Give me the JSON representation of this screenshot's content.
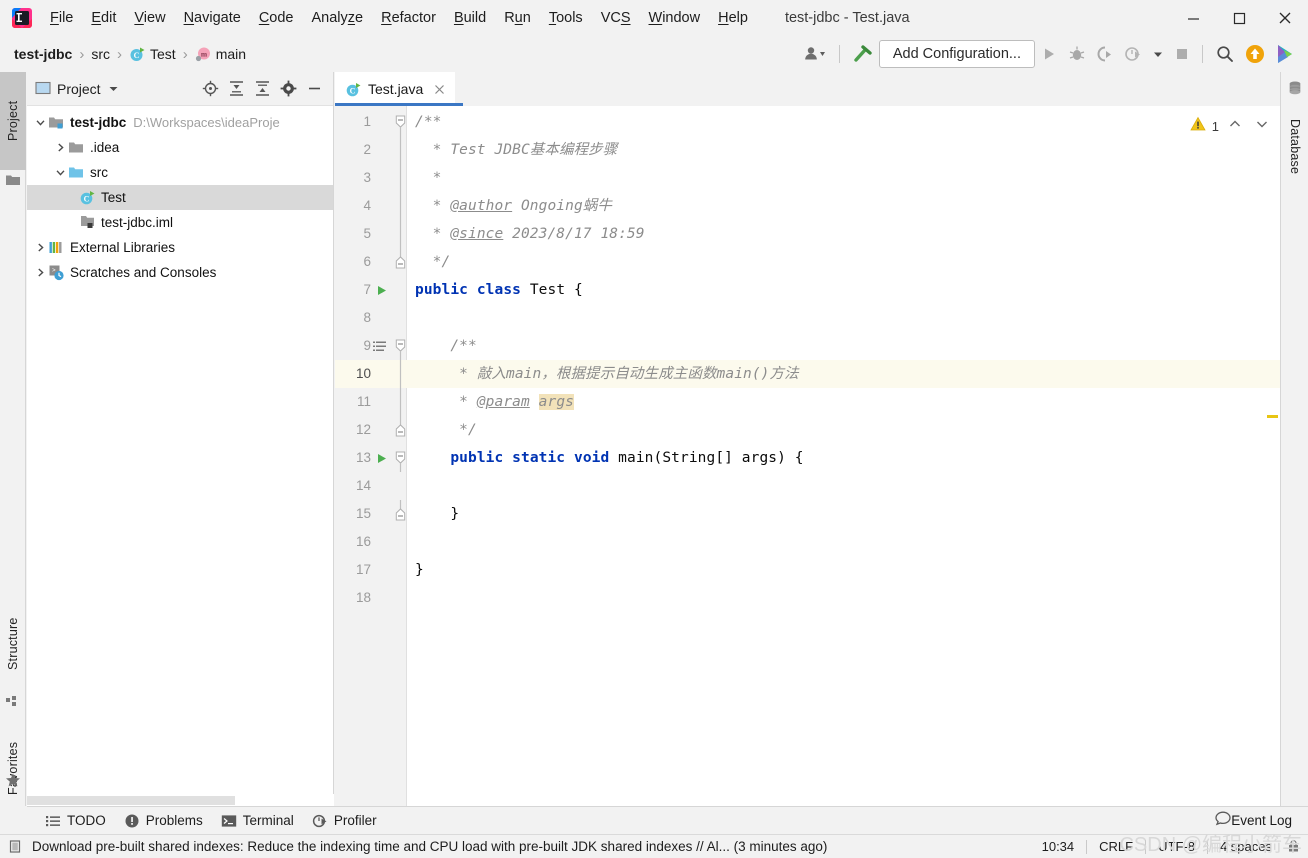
{
  "window": {
    "title": "test-jdbc - Test.java",
    "minimize_label": "Minimize",
    "maximize_label": "Maximize",
    "close_label": "Close"
  },
  "menu": {
    "items": [
      {
        "label": "File"
      },
      {
        "label": "Edit"
      },
      {
        "label": "View"
      },
      {
        "label": "Navigate"
      },
      {
        "label": "Code"
      },
      {
        "label": "Analyze"
      },
      {
        "label": "Refactor"
      },
      {
        "label": "Build"
      },
      {
        "label": "Run"
      },
      {
        "label": "Tools"
      },
      {
        "label": "VCS"
      },
      {
        "label": "Window"
      },
      {
        "label": "Help"
      }
    ]
  },
  "navbar": {
    "breadcrumbs": [
      {
        "label": "test-jdbc",
        "icon": "none"
      },
      {
        "label": "src",
        "icon": "none"
      },
      {
        "label": "Test",
        "icon": "class-icon"
      },
      {
        "label": "main",
        "icon": "method-icon"
      }
    ],
    "separator": "›",
    "run_config_button": "Add Configuration...",
    "icons": [
      "user-avatar-icon",
      "build-hammer-icon",
      "run-icon",
      "debug-icon",
      "run-coverage-icon",
      "profile-icon",
      "dropdown-arrow-icon",
      "stop-icon",
      "search-everywhere-icon",
      "update-project-icon",
      "idea-ultimate-icon"
    ]
  },
  "left_strip": {
    "tabs": [
      {
        "label": "Project",
        "icon": "project-folder-icon",
        "active": true
      },
      {
        "label": "Structure",
        "icon": "structure-icon",
        "active": false
      },
      {
        "label": "Favorites",
        "icon": "favorites-star-icon",
        "active": false
      }
    ]
  },
  "right_strip": {
    "tabs": [
      {
        "label": "Database",
        "icon": "database-icon",
        "active": false
      }
    ]
  },
  "project_panel": {
    "title": "Project",
    "title_dropdown_icon": "chevron-down-icon",
    "header_icons": [
      "locate-icon",
      "expand-all-icon",
      "collapse-all-icon",
      "settings-gear-icon",
      "hide-icon"
    ],
    "tree": [
      {
        "label": "test-jdbc",
        "path": "D:\\Workspaces\\ideaProje",
        "depth": 0,
        "arrow": "down",
        "icon": "module-folder-icon",
        "bold": true,
        "selected": false
      },
      {
        "label": ".idea",
        "path": "",
        "depth": 1,
        "arrow": "right",
        "icon": "folder-icon",
        "bold": false,
        "selected": false
      },
      {
        "label": "src",
        "path": "",
        "depth": 1,
        "arrow": "down",
        "icon": "source-folder-icon",
        "bold": false,
        "selected": false
      },
      {
        "label": "Test",
        "path": "",
        "depth": 2,
        "arrow": "none",
        "icon": "class-icon",
        "bold": false,
        "selected": true
      },
      {
        "label": "test-jdbc.iml",
        "path": "",
        "depth": 2,
        "arrow": "none",
        "icon": "iml-file-icon",
        "bold": false,
        "selected": false
      },
      {
        "label": "External Libraries",
        "path": "",
        "depth": 0,
        "arrow": "right",
        "icon": "libraries-icon",
        "bold": false,
        "selected": false
      },
      {
        "label": "Scratches and Consoles",
        "path": "",
        "depth": 0,
        "arrow": "right",
        "icon": "scratches-icon",
        "bold": false,
        "selected": false
      }
    ]
  },
  "editor": {
    "tab": {
      "name": "Test.java",
      "icon": "java-class-icon",
      "close_icon": "close-icon"
    },
    "inspection": {
      "warning_count": "1",
      "warning_icon": "warning-triangle-icon",
      "prev_icon": "chevron-up-icon",
      "next_icon": "chevron-down-icon"
    },
    "lines": [
      {
        "n": "1",
        "indent": 0,
        "html": "<span class='cm'>/**</span>",
        "fold": "start",
        "run": false,
        "current": false
      },
      {
        "n": "2",
        "indent": 0,
        "html": "<span class='cm'>  * Test JDBC基本编程步骤</span>",
        "fold": "bar",
        "run": false,
        "current": false
      },
      {
        "n": "3",
        "indent": 0,
        "html": "<span class='cm'>  *</span>",
        "fold": "bar",
        "run": false,
        "current": false
      },
      {
        "n": "4",
        "indent": 0,
        "html": "<span class='cm'>  * </span><span class='cm-tag'>@author</span><span class='cm'> Ongoing蜗牛</span>",
        "fold": "bar",
        "run": false,
        "current": false
      },
      {
        "n": "5",
        "indent": 0,
        "html": "<span class='cm'>  * </span><span class='cm-tag'>@since</span><span class='cm'> 2023/8/17 18:59</span>",
        "fold": "bar",
        "run": false,
        "current": false
      },
      {
        "n": "6",
        "indent": 0,
        "html": "<span class='cm'>  */</span>",
        "fold": "end",
        "run": false,
        "current": false
      },
      {
        "n": "7",
        "indent": 0,
        "html": "<span class='kw'>public</span> <span class='kw'>class</span> <span class='ident'>Test</span> {",
        "fold": "none",
        "run": true,
        "current": false
      },
      {
        "n": "8",
        "indent": 0,
        "html": "",
        "fold": "none",
        "run": false,
        "current": false
      },
      {
        "n": "9",
        "indent": 0,
        "html": "    <span class='cm'>/**</span>",
        "fold": "start",
        "run": false,
        "current": false,
        "bookmark": true
      },
      {
        "n": "10",
        "indent": 0,
        "html": "     <span class='cm'>* 敲入main，根据提示自动生成主函数main()方法</span>",
        "fold": "bar",
        "run": false,
        "current": true
      },
      {
        "n": "11",
        "indent": 0,
        "html": "     <span class='cm'>* </span><span class='cm-tag'>@param</span><span class='cm'> </span><span class='cm hl-args'>args</span>",
        "fold": "bar",
        "run": false,
        "current": false
      },
      {
        "n": "12",
        "indent": 0,
        "html": "     <span class='cm'>*/</span>",
        "fold": "end",
        "run": false,
        "current": false
      },
      {
        "n": "13",
        "indent": 0,
        "html": "    <span class='kw'>public</span> <span class='kw'>static</span> <span class='kw'>void</span> <span class='ident'>main</span>(<span class='ident'>String</span>[] args) {",
        "fold": "start",
        "run": true,
        "current": false
      },
      {
        "n": "14",
        "indent": 0,
        "html": "",
        "fold": "none",
        "run": false,
        "current": false
      },
      {
        "n": "15",
        "indent": 0,
        "html": "    }",
        "fold": "end",
        "run": false,
        "current": false
      },
      {
        "n": "16",
        "indent": 0,
        "html": "",
        "fold": "none",
        "run": false,
        "current": false
      },
      {
        "n": "17",
        "indent": 0,
        "html": "}",
        "fold": "none",
        "run": false,
        "current": false
      },
      {
        "n": "18",
        "indent": 0,
        "html": "",
        "fold": "none",
        "run": false,
        "current": false
      }
    ]
  },
  "tool_window_bar": {
    "items": [
      {
        "label": "TODO",
        "icon": "todo-list-icon"
      },
      {
        "label": "Problems",
        "icon": "problems-icon"
      },
      {
        "label": "Terminal",
        "icon": "terminal-icon"
      },
      {
        "label": "Profiler",
        "icon": "profiler-icon"
      }
    ],
    "right_items": [
      {
        "label": "Event Log",
        "icon": "event-log-icon"
      }
    ]
  },
  "status_bar": {
    "message_icon": "notification-icon",
    "message": "Download pre-built shared indexes: Reduce the indexing time and CPU load with pre-built JDK shared indexes // Al... (3 minutes ago)",
    "time": "10:34",
    "line_separator": "CRLF",
    "encoding": "UTF-8",
    "indent": "4 spaces",
    "lock_icon": "read-write-icon"
  },
  "watermark": {
    "text": "CSDN @编程小箭车"
  },
  "colors": {
    "accent_blue": "#3b77c4",
    "keyword_blue": "#0033b3",
    "comment_gray": "#8c8c8c",
    "current_line": "#fcfaed",
    "identifier_highlight": "#f2e2b9",
    "warning_yellow": "#e8c513",
    "selection_gray": "#d9d9d9"
  }
}
